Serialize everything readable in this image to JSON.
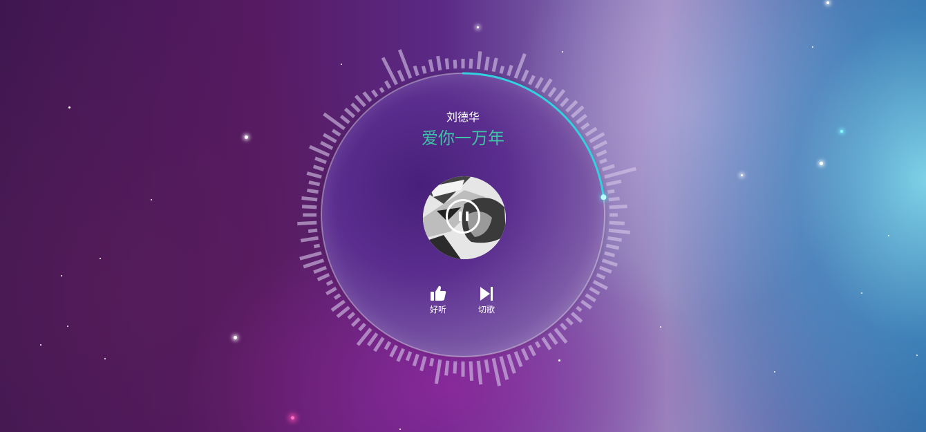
{
  "player": {
    "artist": "刘德华",
    "title": "爱你一万年",
    "state": "playing",
    "progress": 0.23
  },
  "controls": {
    "like": {
      "label": "好听",
      "icon": "thumbs-up-icon"
    },
    "next": {
      "label": "切歌",
      "icon": "skip-next-icon"
    },
    "pause": {
      "icon": "pause-icon"
    }
  },
  "colors": {
    "title": "#3fc3a5",
    "ring": "#33d0e0",
    "spectrum": "#d6c7e8"
  }
}
